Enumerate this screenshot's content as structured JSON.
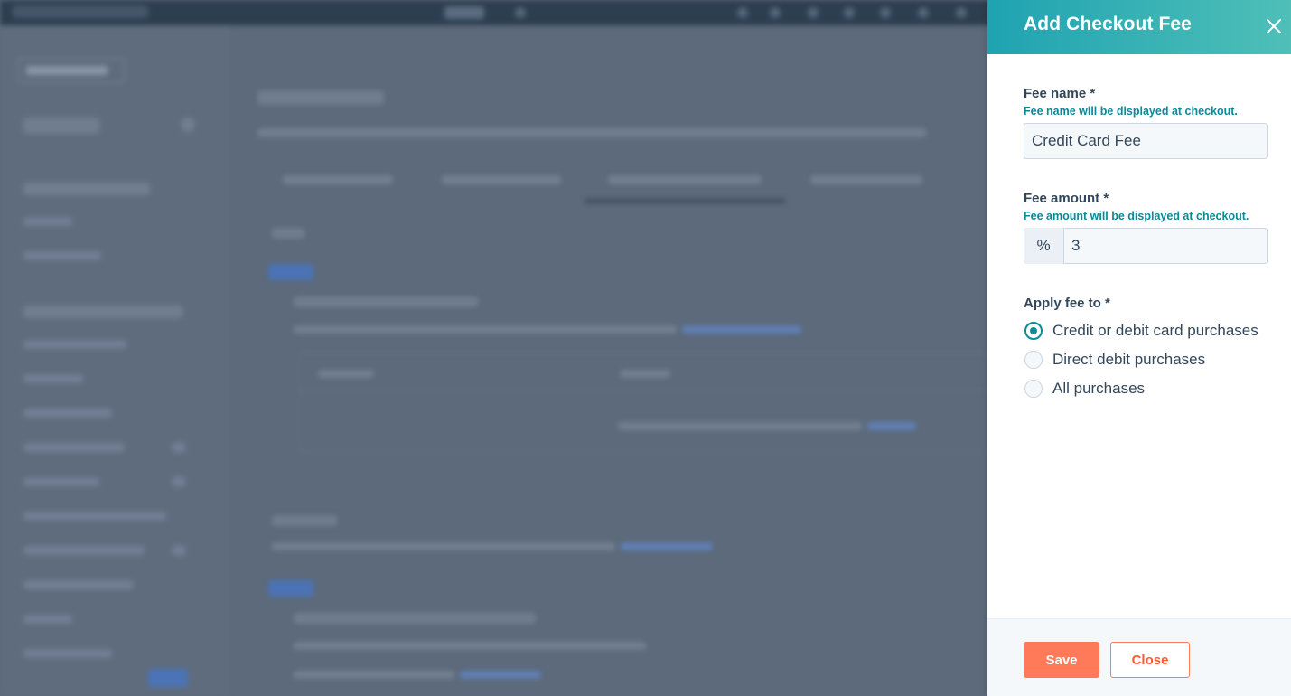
{
  "panel": {
    "title": "Add Checkout Fee",
    "close_icon": "close-icon",
    "fee_name": {
      "label": "Fee name *",
      "help": "Fee name will be displayed at checkout.",
      "value": "Credit Card Fee"
    },
    "fee_amount": {
      "label": "Fee amount *",
      "help": "Fee amount will be displayed at checkout.",
      "prefix": "%",
      "value": "3"
    },
    "apply_fee": {
      "label": "Apply fee to *",
      "options": [
        {
          "label": "Credit or debit card purchases",
          "checked": true
        },
        {
          "label": "Direct debit purchases",
          "checked": false
        },
        {
          "label": "All purchases",
          "checked": false
        }
      ]
    },
    "footer": {
      "save_label": "Save",
      "close_label": "Close"
    }
  },
  "colors": {
    "header_start": "#1fa3b1",
    "header_end": "#4fbfb8",
    "help_text": "#0b8a98",
    "primary_button": "#ff7a59",
    "overlay": "#5c6a7b"
  }
}
